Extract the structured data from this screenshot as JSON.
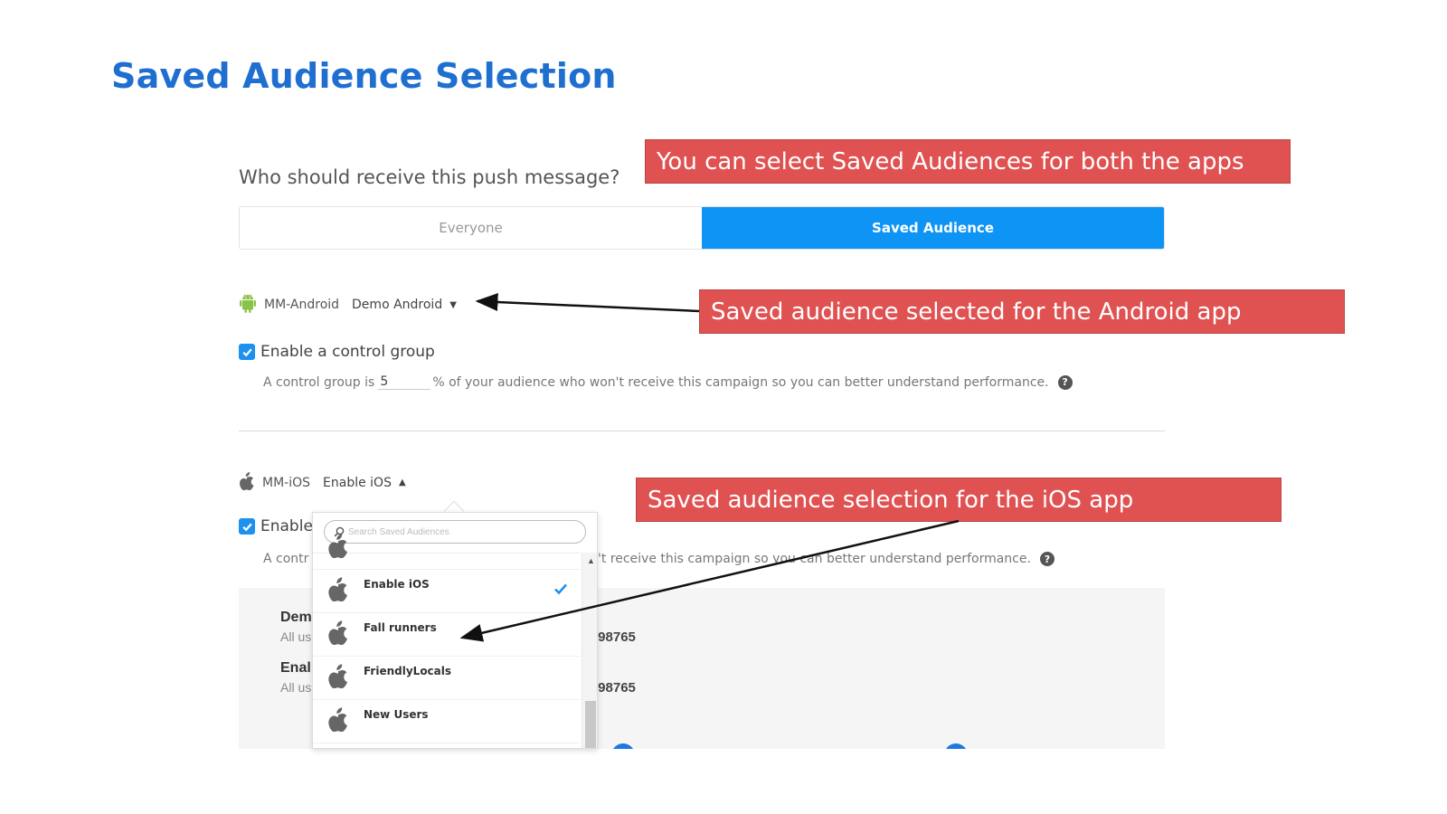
{
  "slide": {
    "title": "Saved Audience Selection"
  },
  "audience": {
    "question": "Who should receive this push message?",
    "options": {
      "everyone": "Everyone",
      "saved": "Saved Audience"
    },
    "selected": "Saved Audience"
  },
  "android": {
    "app_name": "MM-Android",
    "selected_audience": "Demo Android",
    "control_group": {
      "checkbox_label": "Enable a control group",
      "help_prefix": "A control group is",
      "percent_value": "5",
      "help_suffix": "% of your audience who won't receive this campaign so you can better understand performance.",
      "help_icon": "?"
    }
  },
  "ios": {
    "app_name": "MM-iOS",
    "selected_audience": "Enable iOS",
    "control_group": {
      "checkbox_label_visible": "Enable",
      "help_prefix_visible": "A contr",
      "help_suffix_visible": "'t receive this campaign so you can better understand performance.",
      "help_icon": "?"
    }
  },
  "dropdown": {
    "search_placeholder": "Search Saved Audiences",
    "items": [
      {
        "label": "Enable iOS",
        "selected": true
      },
      {
        "label": "Fall runners",
        "selected": false
      },
      {
        "label": "FriendlyLocals",
        "selected": false
      },
      {
        "label": "New Users",
        "selected": false
      }
    ]
  },
  "summary": {
    "rows": [
      {
        "title_visible": "Dem",
        "sub_visible": "All us",
        "count_visible": "f 98765"
      },
      {
        "title_visible": "Enal",
        "sub_visible": "All us",
        "count_visible": "f 98765"
      }
    ]
  },
  "callouts": {
    "both_apps": "You can select Saved Audiences for both the apps",
    "android": "Saved audience selected for the Android app",
    "ios": "Saved audience selection for the iOS app"
  },
  "colors": {
    "title_blue": "#1f6fd1",
    "active_tab": "#0d94f5",
    "checkbox": "#1e90f0",
    "callout_red": "#e05252",
    "android_green": "#8bc34a",
    "apple_gray": "#666666"
  },
  "icons": {
    "android": "android-icon",
    "apple": "apple-icon",
    "search": "search-icon",
    "check": "check-icon",
    "caret_down": "caret-down-icon",
    "caret_up": "caret-up-icon"
  }
}
